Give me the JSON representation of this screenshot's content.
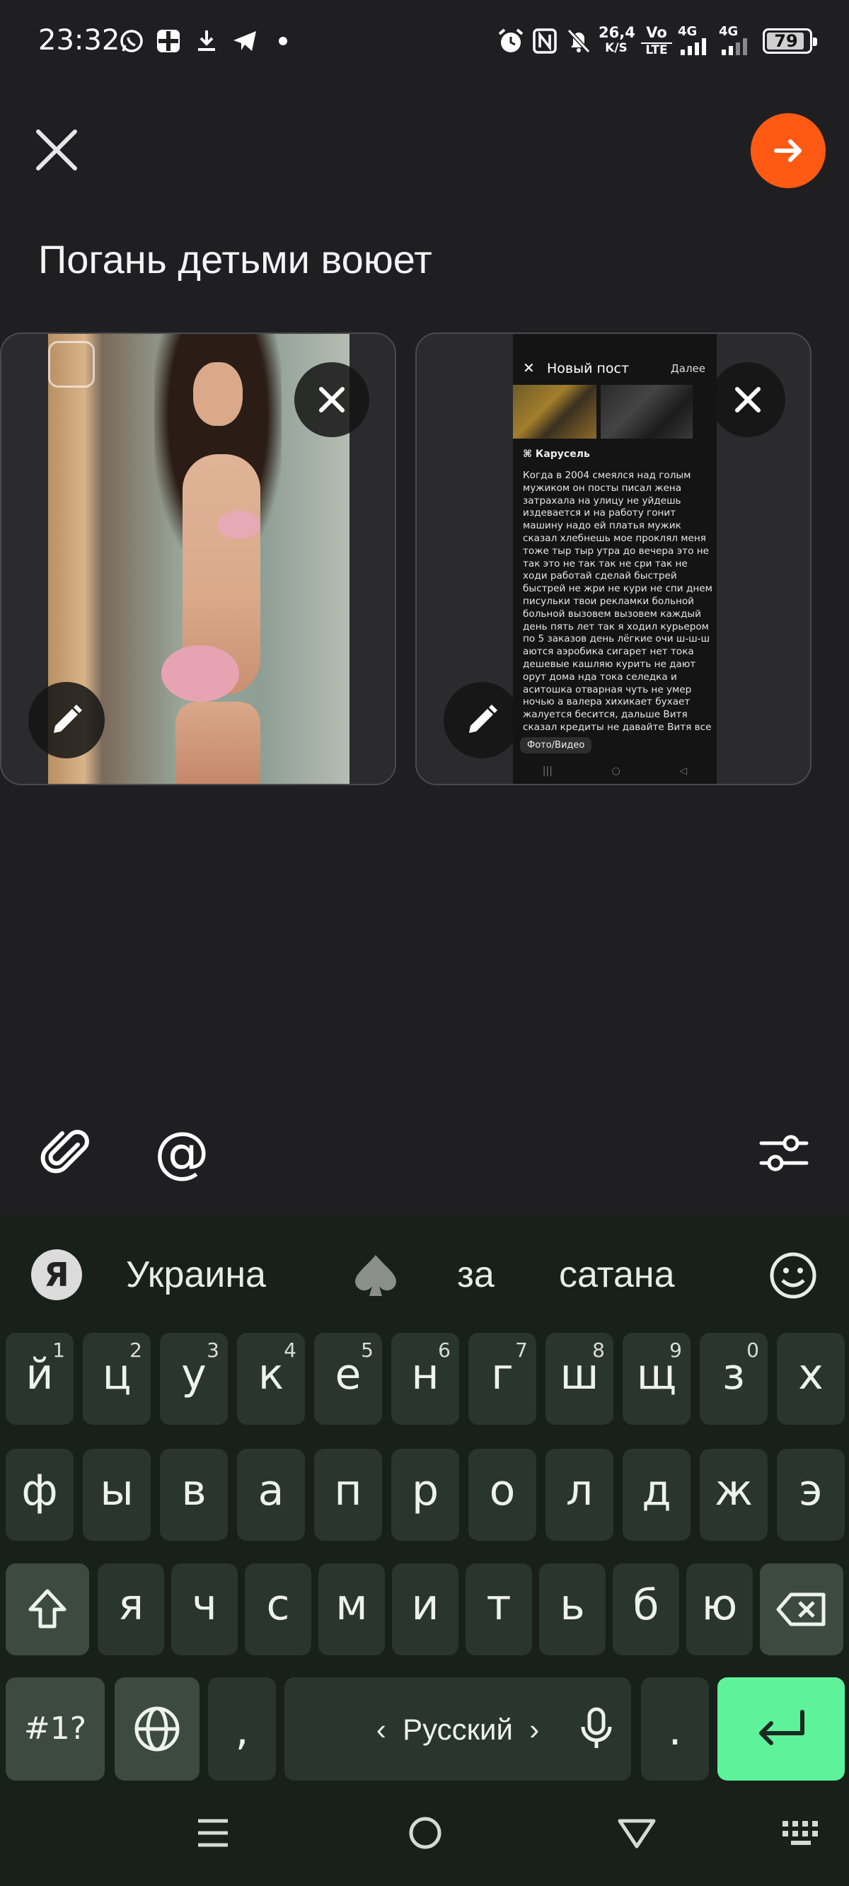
{
  "status_bar": {
    "time": "23:32",
    "speed_value": "26,4",
    "speed_unit": "K/S",
    "vo": "Vo",
    "lte": "LTE",
    "net1": "4G",
    "net2": "4G",
    "battery": "79",
    "icons": [
      "whatsapp-icon",
      "grid-app-icon",
      "download-icon",
      "telegram-icon",
      "dot-icon",
      "alarm-icon",
      "nfc-icon",
      "mute-bell-icon"
    ]
  },
  "header": {
    "close_icon": "close-icon",
    "next_icon": "arrow-right-icon",
    "next_color": "#ff5a14"
  },
  "post": {
    "title": "Погань детьми воюет"
  },
  "attachments": [
    {
      "type": "photo",
      "remove_icon": "close-icon",
      "edit_icon": "pencil-icon"
    },
    {
      "type": "screenshot",
      "remove_icon": "close-icon",
      "edit_icon": "pencil-icon",
      "preview": {
        "close": "✕",
        "title": "Новый пост",
        "next": "Далее",
        "carousel": "Карусель",
        "text": "Когда в 2004 смеялся над голым мужиком он посты писал жена затрахала на улицу не уйдешь издевается и на работу гонит машину надо ей платья мужик сказал хлебнешь мое проклял меня тоже тыр тыр утра до вечера это не так это не так так не сри так не ходи работай сделай быстрей быстрей не жри не кури не спи днем писульки твои рекламки больной больной вызовем вызовем каждый день пять лет так я ходил курьером по 5 заказов день лёгкие очи ш-ш-ш аются аэробика сигарет нет тока дешевые кашляю курить не дают орут дома нда тока селедка и аситошка отварная чуть не умер ночью а валера хихикает бухает жалуется бесится, дальше Витя сказал кредиты не давайте Витя все",
        "chip": "Фото/Видео"
      }
    }
  ],
  "toolbar": {
    "attach_icon": "paperclip-icon",
    "mention": "@",
    "settings_icon": "sliders-icon"
  },
  "keyboard": {
    "logo": "Я",
    "suggestions": [
      "Украина",
      "за",
      "сатана"
    ],
    "suggestion_icons": [
      "spade-icon",
      "emoji-icon"
    ],
    "row1": [
      {
        "c": "й",
        "s": "1"
      },
      {
        "c": "ц",
        "s": "2"
      },
      {
        "c": "у",
        "s": "3"
      },
      {
        "c": "к",
        "s": "4"
      },
      {
        "c": "е",
        "s": "5"
      },
      {
        "c": "н",
        "s": "6"
      },
      {
        "c": "г",
        "s": "7"
      },
      {
        "c": "ш",
        "s": "8"
      },
      {
        "c": "щ",
        "s": "9"
      },
      {
        "c": "з",
        "s": "0"
      },
      {
        "c": "х",
        "s": ""
      }
    ],
    "row2": [
      "ф",
      "ы",
      "в",
      "а",
      "п",
      "р",
      "о",
      "л",
      "д",
      "ж",
      "э"
    ],
    "row3": [
      "я",
      "ч",
      "с",
      "м",
      "и",
      "т",
      "ь",
      "б",
      "ю"
    ],
    "symbols": "#1?",
    "comma": ",",
    "language": "Русский",
    "period": ".",
    "accent_color": "#5ef29a"
  },
  "navbar": {
    "icons": [
      "menu-icon",
      "home-icon",
      "back-icon",
      "keyboard-icon"
    ]
  }
}
